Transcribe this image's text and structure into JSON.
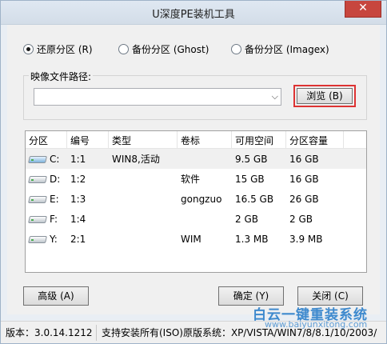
{
  "window": {
    "title": "U深度PE装机工具",
    "close_glyph": "✕"
  },
  "mode": {
    "options": [
      {
        "label": "还原分区 (R)",
        "selected": true
      },
      {
        "label": "备份分区 (Ghost)",
        "selected": false
      },
      {
        "label": "备份分区 (Imagex)",
        "selected": false
      }
    ]
  },
  "image_path": {
    "group_label": "映像文件路径:",
    "value": "",
    "browse_label": "浏览 (B)"
  },
  "partitions": {
    "columns": [
      "分区",
      "编号",
      "类型",
      "卷标",
      "可用空间",
      "分区容量"
    ],
    "rows": [
      {
        "drive": "C:",
        "num": "1:1",
        "type": "WIN8,活动",
        "label": "",
        "free": "9.5 GB",
        "size": "16 GB",
        "selected": true
      },
      {
        "drive": "D:",
        "num": "1:2",
        "type": "",
        "label": "软件",
        "free": "15 GB",
        "size": "16 GB",
        "selected": false
      },
      {
        "drive": "E:",
        "num": "1:3",
        "type": "",
        "label": "gongzuo",
        "free": "16.5 GB",
        "size": "26 GB",
        "selected": false
      },
      {
        "drive": "F:",
        "num": "1:4",
        "type": "",
        "label": "",
        "free": "2 GB",
        "size": "2 GB",
        "selected": false
      },
      {
        "drive": "Y:",
        "num": "2:1",
        "type": "",
        "label": "WIM",
        "free": "1.3 MB",
        "size": "3.9 MB",
        "selected": false
      }
    ]
  },
  "buttons": {
    "advanced": "高级 (A)",
    "ok": "确定 (Y)",
    "close": "关闭 (C)"
  },
  "status": {
    "version": "版本：3.0.14.1212",
    "support": "支持安装所有(ISO)原版系统：XP/VISTA/WIN7/8/8.1/10/2003/"
  },
  "watermark": {
    "text": "白云一键重装系统",
    "url": "www.baiyunxitong.com"
  }
}
